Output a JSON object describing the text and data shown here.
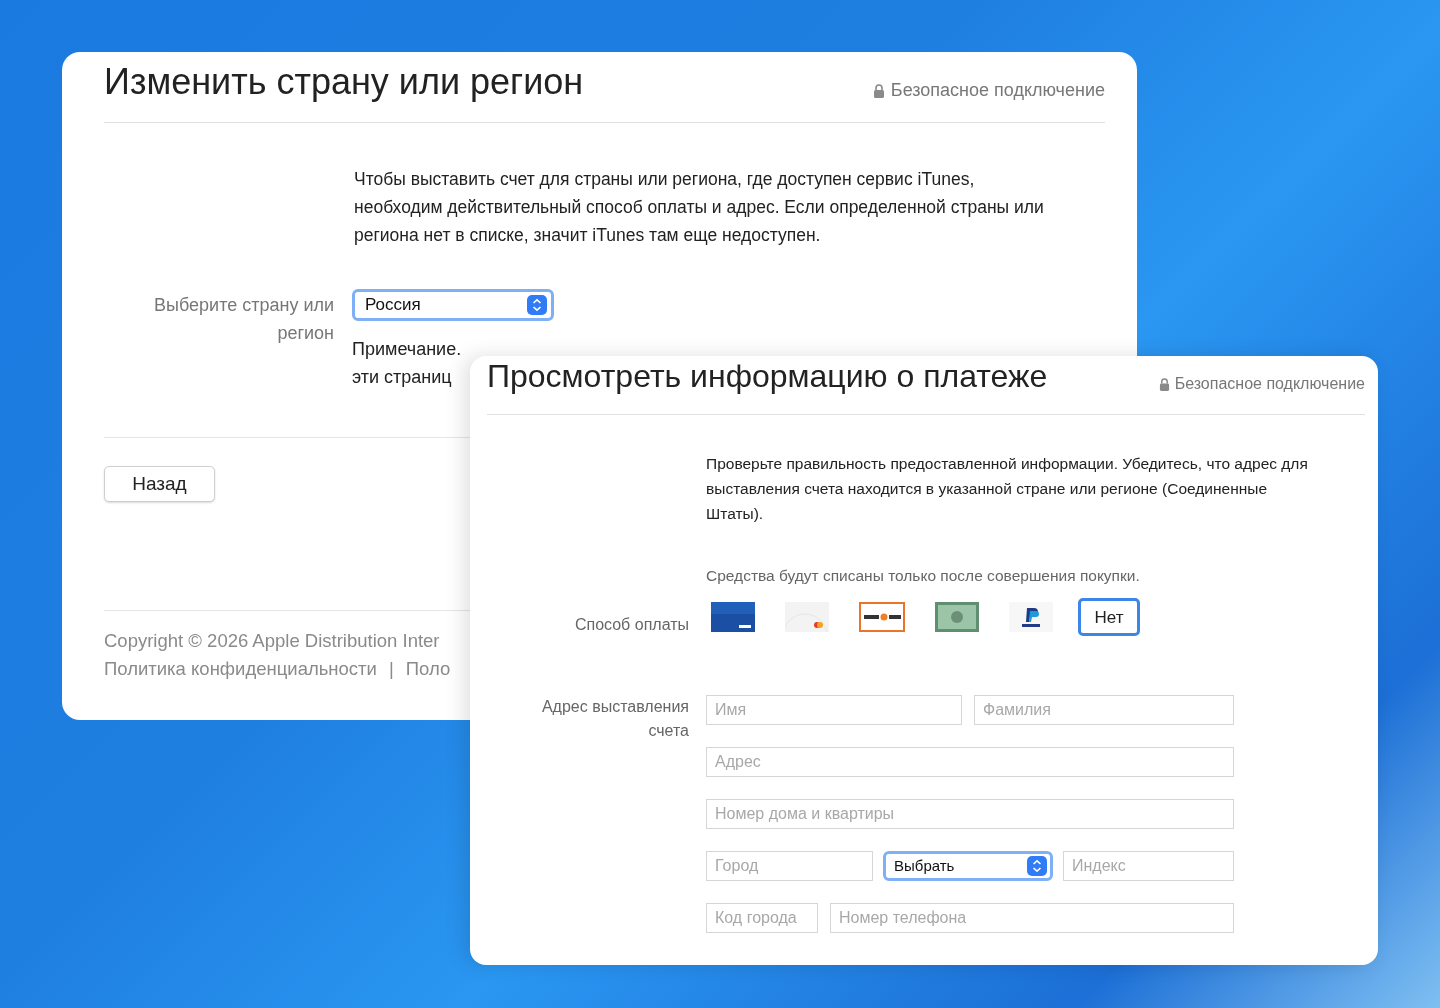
{
  "country_window": {
    "title": "Изменить страну или регион",
    "secure": "Безопасное подключение",
    "intro": "Чтобы выставить счет для страны или региона, где доступен сервис iTunes, необходим действительный способ оплаты и адрес. Если определенной страны или региона нет в списке, значит iTunes там еще недоступен.",
    "country_label": "Выберите страну или регион",
    "country_value": "Россия",
    "note_lines": [
      "Примечание.",
      "эти страниц"
    ],
    "back_button": "Назад",
    "copyright": "Copyright © 2026 Apple Distribution Inter",
    "footer_links": [
      "Политика конфиденциальности",
      "Поло"
    ],
    "footer_separator": "|"
  },
  "payment_window": {
    "title": "Просмотреть информацию о платеже",
    "secure": "Безопасное подключение",
    "intro": "Проверьте правильность предоставленной информации. Убедитесь, что адрес для выставления счета находится в указанной стране или регионе (Соединенные Штаты).",
    "charge_note": "Средства будут списаны только после совершения покупки.",
    "payment_label": "Способ оплаты",
    "payment_methods": [
      {
        "kind": "visa",
        "selected": false
      },
      {
        "kind": "mastercard",
        "selected": false
      },
      {
        "kind": "discover",
        "selected": false
      },
      {
        "kind": "amex",
        "selected": false
      },
      {
        "kind": "paypal",
        "selected": false
      },
      {
        "kind": "none",
        "label": "Нет",
        "selected": true
      }
    ],
    "address_label": "Адрес выставления счета",
    "fields": {
      "first_name": {
        "placeholder": "Имя"
      },
      "last_name": {
        "placeholder": "Фамилия"
      },
      "address": {
        "placeholder": "Адрес"
      },
      "apartment": {
        "placeholder": "Номер дома и квартиры"
      },
      "city": {
        "placeholder": "Город"
      },
      "state_select": {
        "value": "Выбрать"
      },
      "zip": {
        "placeholder": "Индекс"
      },
      "area_code": {
        "placeholder": "Код города"
      },
      "phone": {
        "placeholder": "Номер телефона"
      }
    }
  }
}
